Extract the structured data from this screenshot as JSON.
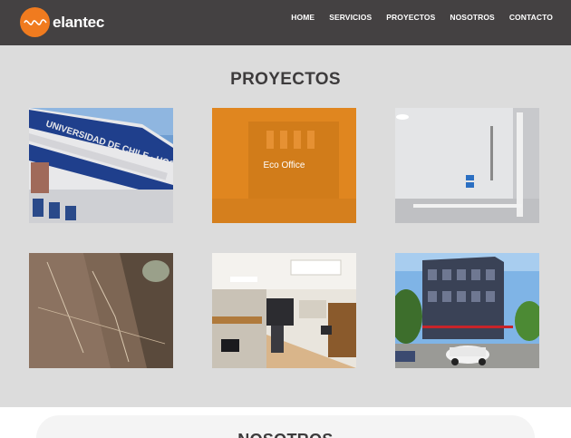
{
  "header": {
    "brand": "elantec",
    "nav": [
      "HOME",
      "SERVICIOS",
      "PROYECTOS",
      "NOSOTROS",
      "CONTACTO"
    ]
  },
  "projects": {
    "title": "PROYECTOS",
    "items": [
      {
        "label": ""
      },
      {
        "label": "Eco Office"
      },
      {
        "label": ""
      },
      {
        "label": ""
      },
      {
        "label": ""
      },
      {
        "label": ""
      }
    ]
  },
  "next_section": {
    "title": "NOSOTROS"
  },
  "colors": {
    "header_bg": "#444142",
    "accent": "#f07b1f",
    "overlay": "#e0861f",
    "page_bg": "#dcdcdc"
  },
  "icons": {
    "logo": "wave-logo-icon"
  },
  "photo_captions": {
    "tile1_sign": "UNIVERSIDAD DE CHILE · HOSPITAL CLINICO"
  }
}
